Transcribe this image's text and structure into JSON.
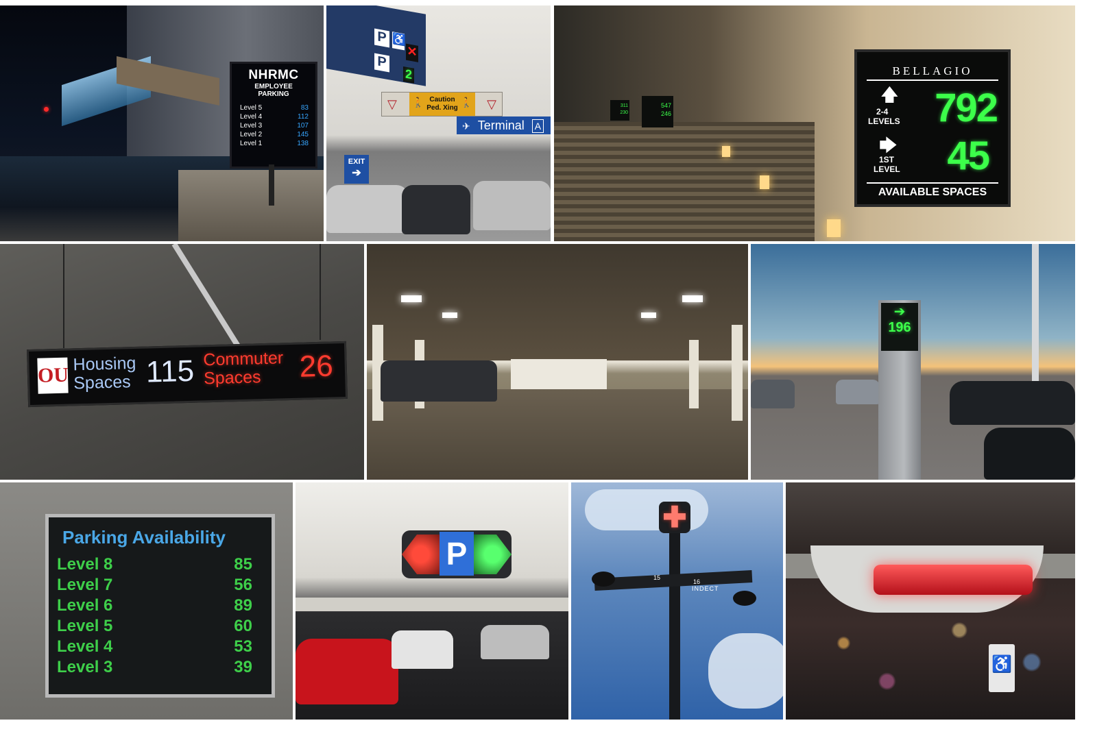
{
  "nhrmc": {
    "title": "NHRMC",
    "subtitle1": "EMPLOYEE",
    "subtitle2": "PARKING",
    "rows": [
      {
        "level": "Level 5",
        "count": "83"
      },
      {
        "level": "Level 4",
        "count": "112"
      },
      {
        "level": "Level 3",
        "count": "107"
      },
      {
        "level": "Level 2",
        "count": "145"
      },
      {
        "level": "Level 1",
        "count": "138"
      }
    ]
  },
  "airport": {
    "caution_line1": "Caution",
    "caution_line2": "Ped. Xing",
    "terminal": "Terminal",
    "terminal_letter": "A",
    "exit": "EXIT",
    "p1": "P",
    "p2": "P",
    "count": "2"
  },
  "bellagio": {
    "brand": "BELLAGIO",
    "levels_upper": "2-4",
    "levels_upper_label": "LEVELS",
    "count_upper": "792",
    "level_lower": "1ST",
    "level_lower_label": "LEVEL",
    "count_lower": "45",
    "footer": "AVAILABLE SPACES",
    "far_sign_a": "547",
    "far_sign_b": "246",
    "far_sign_c": "311",
    "far_sign_d": "230"
  },
  "ou": {
    "housing_line1": "Housing",
    "housing_line2": "Spaces",
    "housing_count": "115",
    "commuter_line1": "Commuter",
    "commuter_line2": "Spaces",
    "commuter_count": "26"
  },
  "rooftop": {
    "count": "196"
  },
  "availability": {
    "title": "Parking Availability",
    "rows": [
      {
        "level": "Level 8",
        "count": "85"
      },
      {
        "level": "Level 7",
        "count": "56"
      },
      {
        "level": "Level 6",
        "count": "89"
      },
      {
        "level": "Level 5",
        "count": "60"
      },
      {
        "level": "Level 4",
        "count": "53"
      },
      {
        "level": "Level 3",
        "count": "39"
      }
    ]
  },
  "ceiling_p": {
    "letter": "P"
  },
  "pole": {
    "num_left": "15",
    "num_right": "16",
    "brand": "INDECT"
  },
  "colors": {
    "led_green": "#3cff4a",
    "led_blue": "#37a6ff",
    "led_red": "#ff3b2f",
    "sign_blue": "#1e4fa3",
    "caution_yellow": "#e2a41a"
  }
}
